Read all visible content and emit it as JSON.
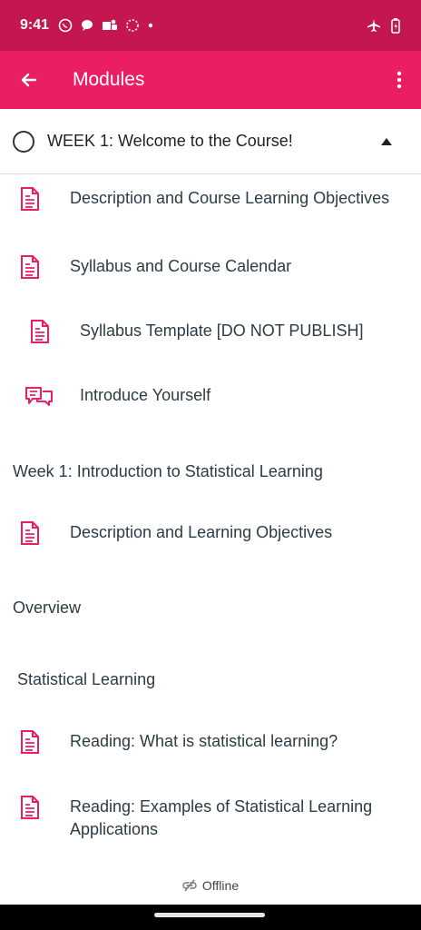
{
  "status_bar": {
    "time": "9:41",
    "left_icons": [
      "whatsapp-icon",
      "chat-icon",
      "teams-icon",
      "loading-icon",
      "dot-icon"
    ],
    "right_icons": [
      "airplane-icon",
      "battery-icon"
    ]
  },
  "app_bar": {
    "title": "Modules",
    "back_icon": "arrow-left-icon",
    "menu_icon": "more-vert-icon",
    "color": "#e91e63"
  },
  "module": {
    "title": "WEEK 1: Welcome to the Course!",
    "items": [
      {
        "label": "Description and Course Learning Objectives",
        "icon": "page-icon"
      },
      {
        "label": "Syllabus and Course Calendar",
        "icon": "page-icon"
      },
      {
        "label": "Syllabus Template [DO NOT PUBLISH]",
        "icon": "page-icon"
      },
      {
        "label": "Introduce Yourself",
        "icon": "discussion-icon"
      }
    ],
    "subheaders": [
      {
        "label": "Week 1: Introduction to Statistical Learning"
      },
      {
        "label": "Overview"
      },
      {
        "label": "Statistical Learning"
      }
    ],
    "week1_items": [
      {
        "label": "Description and Learning Objectives",
        "icon": "page-icon"
      }
    ],
    "statistical_items": [
      {
        "label": "Reading: What is statistical learning?",
        "icon": "page-icon"
      },
      {
        "label": "Reading: Examples of Statistical Learning Applications",
        "icon": "page-icon"
      }
    ]
  },
  "footer": {
    "offline_label": "Offline",
    "icon": "offline-icon"
  },
  "accent_color": "#e91e63"
}
